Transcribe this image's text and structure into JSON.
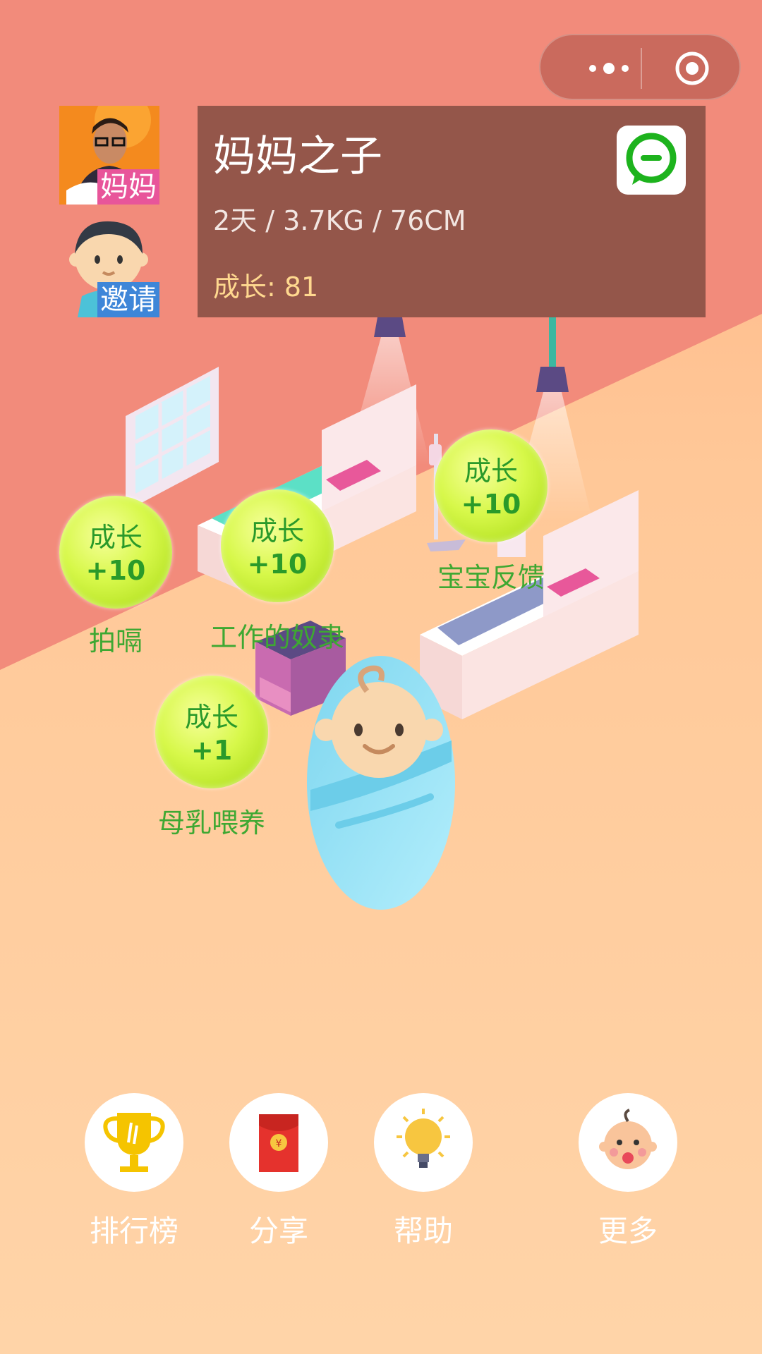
{
  "profile": {
    "mom_tag": "妈妈",
    "invite_tag": "邀请"
  },
  "info": {
    "name": "妈妈之子",
    "stats": "2天 / 3.7KG / 76CM",
    "growth": "成长: 81"
  },
  "bubbles": [
    {
      "label": "成长",
      "value": "+10",
      "caption": "拍嗝"
    },
    {
      "label": "成长",
      "value": "+10",
      "caption": "工作的奴隶"
    },
    {
      "label": "成长",
      "value": "+10",
      "caption": "宝宝反馈"
    },
    {
      "label": "成长",
      "value": "+1",
      "caption": "母乳喂养"
    }
  ],
  "nav": [
    {
      "label": "排行榜",
      "icon": "trophy-icon"
    },
    {
      "label": "分享",
      "icon": "red-envelope-icon"
    },
    {
      "label": "帮助",
      "icon": "lightbulb-icon"
    },
    {
      "label": "更多",
      "icon": "baby-face-icon"
    }
  ],
  "colors": {
    "top_wall": "#f28b7b",
    "floor": "#ffd2a8",
    "info_panel": "#94564a",
    "bubble_text": "#2a9a2a",
    "caption_text": "#3ea832"
  }
}
